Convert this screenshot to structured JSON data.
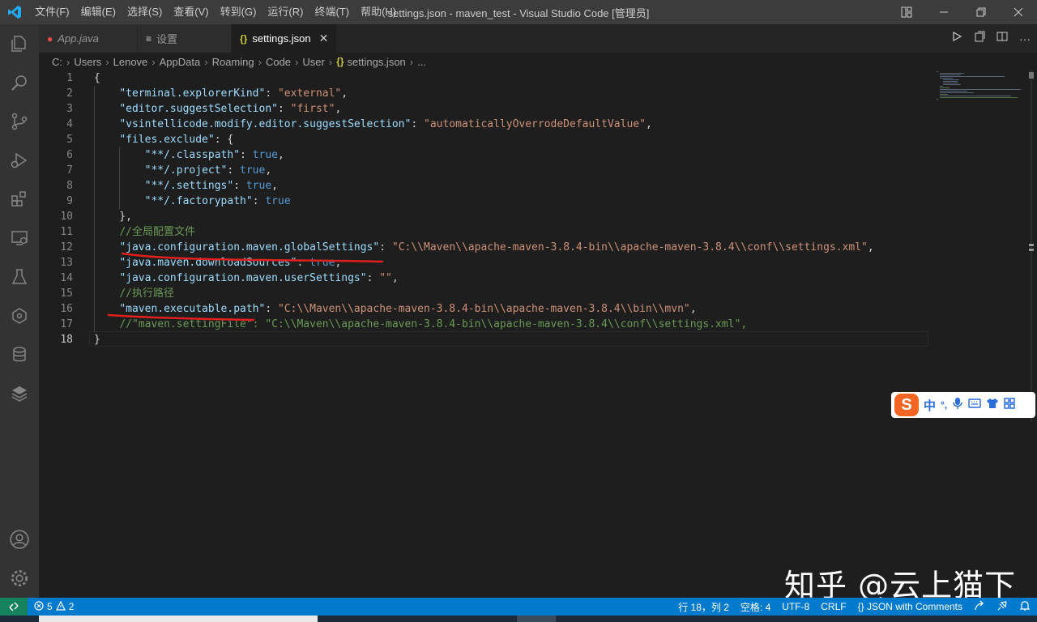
{
  "titlebar": {
    "menu": [
      "文件(F)",
      "编辑(E)",
      "选择(S)",
      "查看(V)",
      "转到(G)",
      "运行(R)",
      "终端(T)",
      "帮助(H)"
    ],
    "title": "settings.json - maven_test - Visual Studio Code [管理员]"
  },
  "activity_icons": [
    "explorer-icon",
    "search-icon",
    "source-control-icon",
    "run-debug-icon",
    "extensions-icon",
    "remote-explorer-icon",
    "testing-icon",
    "gitlens-icon",
    "database-icon",
    "layers-icon",
    "account-icon",
    "settings-gear-icon"
  ],
  "tabs": [
    {
      "label": "App.java",
      "icon": "error-dot"
    },
    {
      "label": "设置",
      "icon": "settings-list-icon"
    },
    {
      "label": "settings.json",
      "icon": "json-braces-icon",
      "active": true
    }
  ],
  "breadcrumb": [
    "C:",
    "Users",
    "Lenove",
    "AppData",
    "Roaming",
    "Code",
    "User",
    "settings.json",
    "..."
  ],
  "editor": {
    "line_numbers": [
      "1",
      "2",
      "3",
      "4",
      "5",
      "6",
      "7",
      "8",
      "9",
      "10",
      "11",
      "12",
      "13",
      "14",
      "15",
      "16",
      "17",
      "18"
    ],
    "current_line": "18",
    "lines": [
      [
        [
          "p",
          "{"
        ]
      ],
      [
        [
          "p",
          "    "
        ],
        [
          "k",
          "\"terminal.explorerKind\""
        ],
        [
          "p",
          ": "
        ],
        [
          "s",
          "\"external\""
        ],
        [
          "p",
          ","
        ]
      ],
      [
        [
          "p",
          "    "
        ],
        [
          "k",
          "\"editor.suggestSelection\""
        ],
        [
          "p",
          ": "
        ],
        [
          "s",
          "\"first\""
        ],
        [
          "p",
          ","
        ]
      ],
      [
        [
          "p",
          "    "
        ],
        [
          "k",
          "\"vsintellicode.modify.editor.suggestSelection\""
        ],
        [
          "p",
          ": "
        ],
        [
          "s",
          "\"automaticallyOverrodeDefaultValue\""
        ],
        [
          "p",
          ","
        ]
      ],
      [
        [
          "p",
          "    "
        ],
        [
          "k",
          "\"files.exclude\""
        ],
        [
          "p",
          ": {"
        ]
      ],
      [
        [
          "p",
          "        "
        ],
        [
          "k",
          "\"**/.classpath\""
        ],
        [
          "p",
          ": "
        ],
        [
          "b",
          "true"
        ],
        [
          "p",
          ","
        ]
      ],
      [
        [
          "p",
          "        "
        ],
        [
          "k",
          "\"**/.project\""
        ],
        [
          "p",
          ": "
        ],
        [
          "b",
          "true"
        ],
        [
          "p",
          ","
        ]
      ],
      [
        [
          "p",
          "        "
        ],
        [
          "k",
          "\"**/.settings\""
        ],
        [
          "p",
          ": "
        ],
        [
          "b",
          "true"
        ],
        [
          "p",
          ","
        ]
      ],
      [
        [
          "p",
          "        "
        ],
        [
          "k",
          "\"**/.factorypath\""
        ],
        [
          "p",
          ": "
        ],
        [
          "b",
          "true"
        ]
      ],
      [
        [
          "p",
          "    },"
        ]
      ],
      [
        [
          "p",
          "    "
        ],
        [
          "c",
          "//全局配置文件"
        ]
      ],
      [
        [
          "p",
          "    "
        ],
        [
          "k",
          "\"java.configuration.maven.globalSettings\""
        ],
        [
          "p",
          ": "
        ],
        [
          "s",
          "\"C:\\\\Maven\\\\apache-maven-3.8.4-bin\\\\apache-maven-3.8.4\\\\conf\\\\settings.xml\""
        ],
        [
          "p",
          ","
        ]
      ],
      [
        [
          "p",
          "    "
        ],
        [
          "k",
          "\"java.maven.downloadSources\""
        ],
        [
          "p",
          ": "
        ],
        [
          "b",
          "true"
        ],
        [
          "p",
          ","
        ]
      ],
      [
        [
          "p",
          "    "
        ],
        [
          "k",
          "\"java.configuration.maven.userSettings\""
        ],
        [
          "p",
          ": "
        ],
        [
          "s",
          "\"\""
        ],
        [
          "p",
          ","
        ]
      ],
      [
        [
          "p",
          "    "
        ],
        [
          "c",
          "//执行路径"
        ]
      ],
      [
        [
          "p",
          "    "
        ],
        [
          "k",
          "\"maven.executable.path\""
        ],
        [
          "p",
          ": "
        ],
        [
          "s",
          "\"C:\\\\Maven\\\\apache-maven-3.8.4-bin\\\\apache-maven-3.8.4\\\\bin\\\\mvn\""
        ],
        [
          "p",
          ","
        ]
      ],
      [
        [
          "p",
          "    "
        ],
        [
          "c",
          "//\"maven.settingFile\": \"C:\\\\Maven\\\\apache-maven-3.8.4-bin\\\\apache-maven-3.8.4\\\\conf\\\\settings.xml\","
        ]
      ],
      [
        [
          "p",
          "}"
        ]
      ]
    ]
  },
  "ime": {
    "chinese": "中",
    "punct": "°,"
  },
  "watermark": "知乎 @云上猫下",
  "statusbar": {
    "errors": "5",
    "warnings": "2",
    "position": "行 18，列 2",
    "spaces": "空格: 4",
    "encoding": "UTF-8",
    "eol": "CRLF",
    "language": "JSON with Comments"
  },
  "colors": {
    "accent": "#007acc",
    "annotation_red": "#e0201f",
    "key": "#9cdcfe",
    "string": "#ce9178",
    "comment": "#6a9955",
    "boolean": "#569cd6"
  }
}
